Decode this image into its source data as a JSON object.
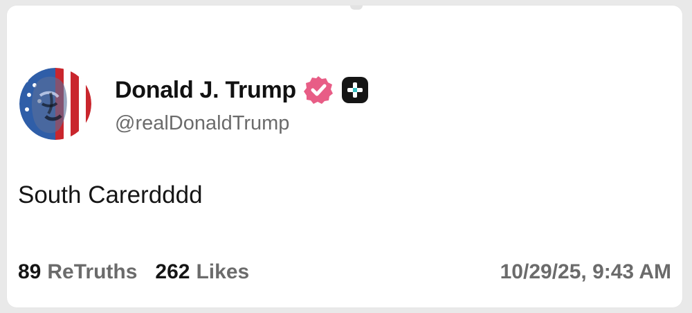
{
  "post": {
    "author": {
      "display_name": "Donald J. Trump",
      "handle": "@realDonaldTrump",
      "verified_badge": "verified-badge-icon",
      "plus_badge": "plus-badge-icon"
    },
    "text": "South Carerdddd",
    "stats": {
      "retruths_count": "89",
      "retruths_label": "ReTruths",
      "likes_count": "262",
      "likes_label": "Likes"
    },
    "timestamp": "10/29/25, 9:43 AM"
  },
  "colors": {
    "background": "#e9e9e9",
    "card": "#ffffff",
    "verified_badge": "#e85d86",
    "plus_badge": "#151515",
    "secondary_text": "#6b6b6b"
  }
}
